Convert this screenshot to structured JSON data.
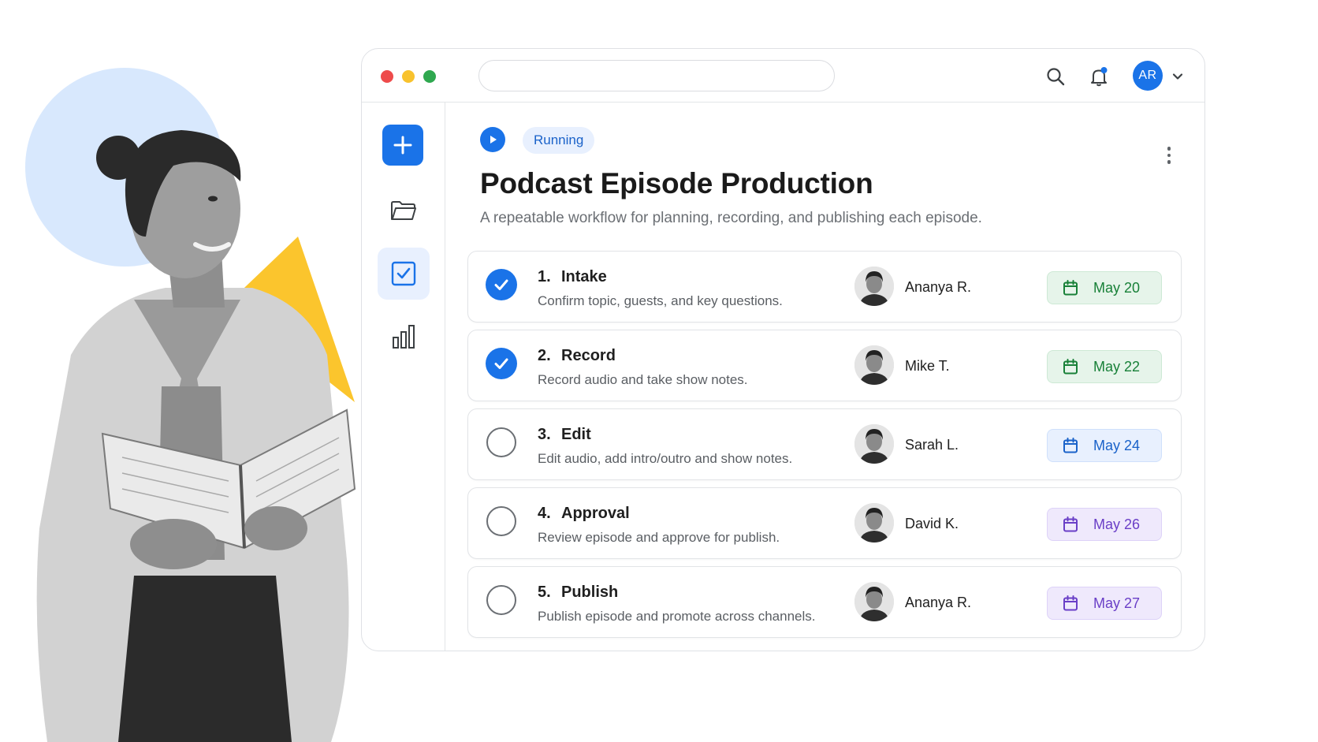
{
  "header": {
    "avatar_initials": "AR",
    "icons": [
      "search-icon",
      "bell-icon",
      "chevron-down-icon"
    ],
    "notification_dot_color": "#1a73e8"
  },
  "sidebar": {
    "items": [
      {
        "icon": "plus-icon",
        "active": false
      },
      {
        "icon": "folder-icon",
        "active": false
      },
      {
        "icon": "checkbox-icon",
        "active": true
      },
      {
        "icon": "bar-chart-icon",
        "active": false
      }
    ]
  },
  "workflow": {
    "status": "Running",
    "title": "Podcast Episode Production",
    "subtitle": "A repeatable workflow for planning, recording, and publishing each episode."
  },
  "steps": [
    {
      "num": "1.",
      "title": "Intake",
      "desc": "Confirm topic, guests, and key questions.",
      "assignee": "Ananya R.",
      "due": "May 20",
      "done": true,
      "due_color": "green"
    },
    {
      "num": "2.",
      "title": "Record",
      "desc": "Record audio and take show notes.",
      "assignee": "Mike T.",
      "due": "May 22",
      "done": true,
      "due_color": "green"
    },
    {
      "num": "3.",
      "title": "Edit",
      "desc": "Edit audio, add intro/outro and show notes.",
      "assignee": "Sarah L.",
      "due": "May 24",
      "done": false,
      "due_color": "blue"
    },
    {
      "num": "4.",
      "title": "Approval",
      "desc": "Review episode and approve for publish.",
      "assignee": "David K.",
      "due": "May 26",
      "done": false,
      "due_color": "purple"
    },
    {
      "num": "5.",
      "title": "Publish",
      "desc": "Publish episode and promote across channels.",
      "assignee": "Ananya R.",
      "due": "May 27",
      "done": false,
      "due_color": "purple"
    }
  ],
  "colors": {
    "accent": "#1a73e8",
    "done_chip": "#e6f4ea",
    "upcoming_chip": "#e8f0fe",
    "later_chip": "#efe9fc",
    "hero_circle": "#d8e8fd",
    "hero_triangle": "#fbc52d"
  }
}
